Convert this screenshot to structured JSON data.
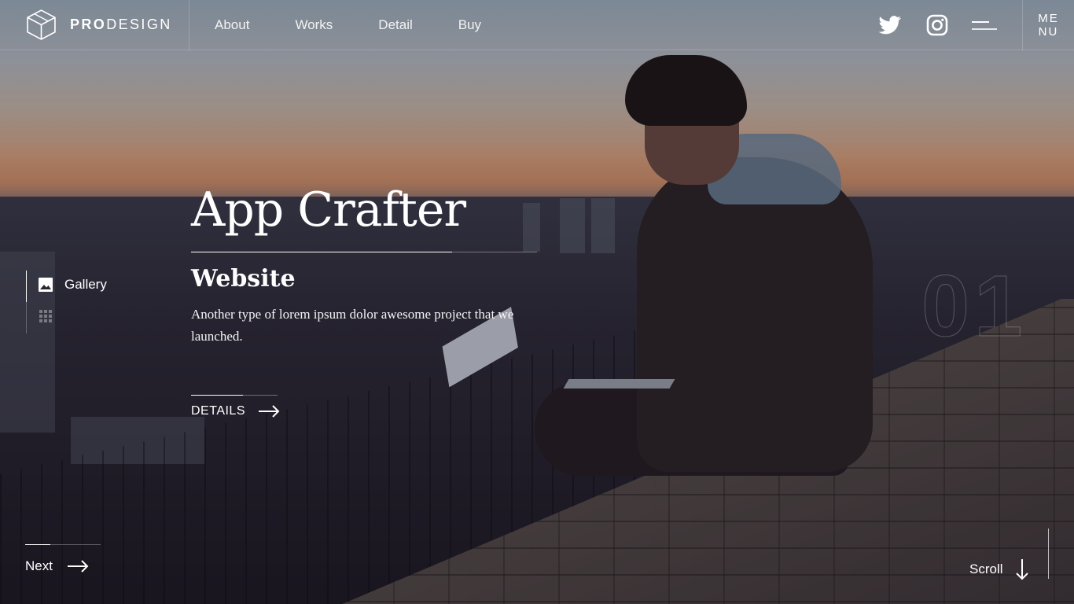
{
  "brand": {
    "bold": "PRO",
    "light": "DESIGN",
    "logo_icon": "cube-icon"
  },
  "nav": {
    "items": [
      "About",
      "Works",
      "Detail",
      "Buy"
    ]
  },
  "header_right": {
    "twitter_icon": "twitter-icon",
    "instagram_icon": "instagram-icon",
    "menu_line1": "ME",
    "menu_line2": "NU"
  },
  "hero": {
    "title": "App Crafter",
    "subtitle": "Website",
    "description": "Another type of lorem ipsum dolor awesome project that we launched.",
    "details_label": "DETAILS"
  },
  "side": {
    "gallery_label": "Gallery"
  },
  "slide_number": "01",
  "footer": {
    "next_label": "Next",
    "scroll_label": "Scroll"
  },
  "colors": {
    "text": "#ffffff",
    "sunset": "#d9a482",
    "dark": "#1f1a24"
  }
}
